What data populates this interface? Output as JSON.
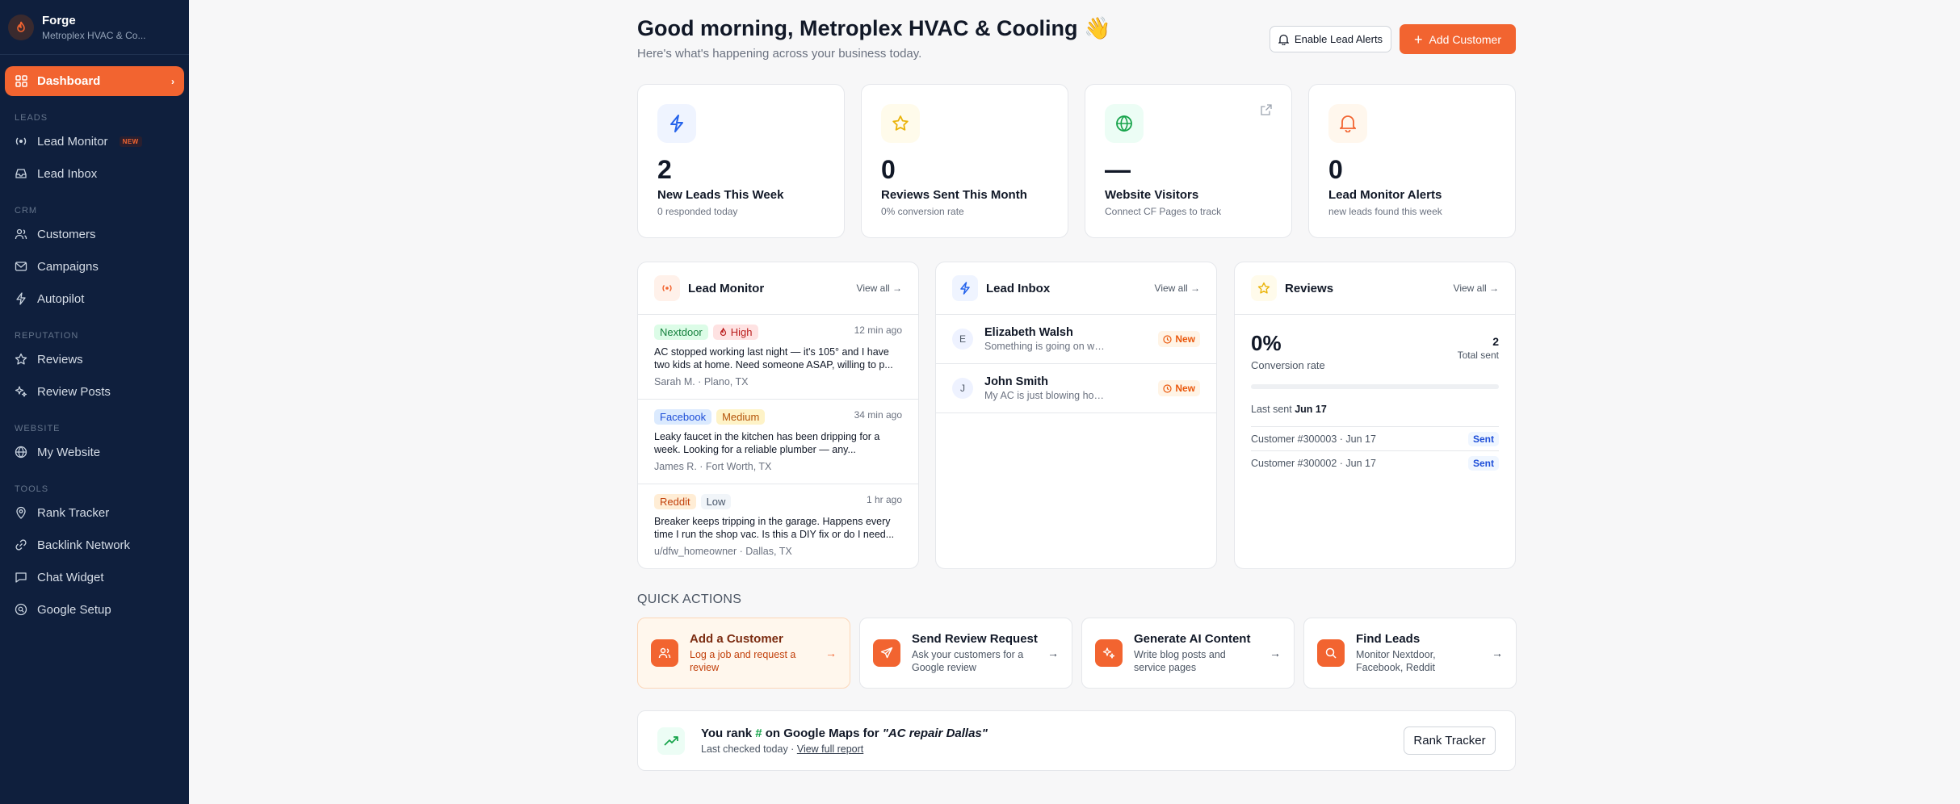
{
  "brand": {
    "name": "Forge",
    "subtitle": "Metroplex HVAC & Co..."
  },
  "nav": {
    "dashboard": "Dashboard",
    "sections": {
      "leads": "LEADS",
      "crm": "CRM",
      "reputation": "REPUTATION",
      "website": "WEBSITE",
      "tools": "TOOLS"
    },
    "items": {
      "lead_monitor": "Lead Monitor",
      "new_badge": "NEW",
      "lead_inbox": "Lead Inbox",
      "customers": "Customers",
      "campaigns": "Campaigns",
      "autopilot": "Autopilot",
      "reviews": "Reviews",
      "review_posts": "Review Posts",
      "my_website": "My Website",
      "rank_tracker": "Rank Tracker",
      "backlink_network": "Backlink Network",
      "chat_widget": "Chat Widget",
      "google_setup": "Google Setup"
    }
  },
  "header": {
    "title": "Good morning, Metroplex HVAC & Cooling 👋",
    "subtitle": "Here's what's happening across your business today.",
    "enable_alerts": "Enable Lead Alerts",
    "add_customer": "Add Customer"
  },
  "stats": [
    {
      "value": "2",
      "label": "New Leads This Week",
      "sub": "0 responded today"
    },
    {
      "value": "0",
      "label": "Reviews Sent This Month",
      "sub": "0% conversion rate"
    },
    {
      "value": "—",
      "label": "Website Visitors",
      "sub": "Connect CF Pages to track"
    },
    {
      "value": "0",
      "label": "Lead Monitor Alerts",
      "sub": "new leads found this week"
    }
  ],
  "lead_monitor": {
    "title": "Lead Monitor",
    "view_all": "View all →",
    "items": [
      {
        "source": "Nextdoor",
        "priority": "High",
        "time": "12 min ago",
        "text": "AC stopped working last night — it's 105° and I have two kids at home. Need someone ASAP, willing to p...",
        "meta": "Sarah M. · Plano, TX"
      },
      {
        "source": "Facebook",
        "priority": "Medium",
        "time": "34 min ago",
        "text": "Leaky faucet in the kitchen has been dripping for a week. Looking for a reliable plumber — any...",
        "meta": "James R. · Fort Worth, TX"
      },
      {
        "source": "Reddit",
        "priority": "Low",
        "time": "1 hr ago",
        "text": "Breaker keeps tripping in the garage. Happens every time I run the shop vac. Is this a DIY fix or do I need...",
        "meta": "u/dfw_homeowner · Dallas, TX"
      }
    ]
  },
  "lead_inbox": {
    "title": "Lead Inbox",
    "view_all": "View all →",
    "items": [
      {
        "initial": "E",
        "name": "Elizabeth Walsh",
        "preview": "Something is going on with my ...",
        "status": "New"
      },
      {
        "initial": "J",
        "name": "John Smith",
        "preview": "My AC is just blowing hot air",
        "status": "New"
      }
    ]
  },
  "reviews": {
    "title": "Reviews",
    "view_all": "View all →",
    "conversion": "0%",
    "conversion_label": "Conversion rate",
    "total": "2",
    "total_label": "Total sent",
    "progress": 0,
    "last_sent_label": "Last sent",
    "last_sent_date": "Jun 17",
    "rows": [
      {
        "label": "Customer #300003 · Jun 17",
        "status": "Sent"
      },
      {
        "label": "Customer #300002 · Jun 17",
        "status": "Sent"
      }
    ]
  },
  "quick_actions": {
    "title": "QUICK ACTIONS",
    "items": [
      {
        "title": "Add a Customer",
        "desc": "Log a job and request a review"
      },
      {
        "title": "Send Review Request",
        "desc": "Ask your customers for a Google review"
      },
      {
        "title": "Generate AI Content",
        "desc": "Write blog posts and service pages"
      },
      {
        "title": "Find Leads",
        "desc": "Monitor Nextdoor, Facebook, Reddit"
      }
    ]
  },
  "rank": {
    "prefix": "You rank ",
    "hash": "#",
    "middle": " on Google Maps for ",
    "keyword": "\"AC repair Dallas\"",
    "checked": "Last checked today · ",
    "report_link": "View full report",
    "button": "Rank Tracker"
  },
  "colors": {
    "accent": "#f26430",
    "sidebar": "#0f1f3d",
    "tag_nextdoor": "#dcfce7",
    "tag_facebook": "#dbeafe",
    "tag_reddit": "#ffedd5",
    "priority_high": "#fee2e2",
    "priority_medium": "#fef3c7",
    "priority_low": "#f1f5f9"
  }
}
